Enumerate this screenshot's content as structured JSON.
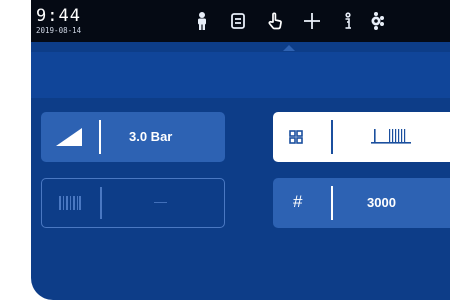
{
  "status_bar": {
    "time": "9:44",
    "date": "2019-08-14",
    "icons": [
      "person-icon",
      "document-icon",
      "hand-pointer-icon",
      "plus-icon",
      "info-icon",
      "settings-icon"
    ],
    "active_icon": "hand-pointer-icon"
  },
  "tiles": {
    "pressure_value": "3.0 Bar",
    "empty_value": "—",
    "count_value": "3000",
    "count_symbol": "#"
  },
  "colors": {
    "background": "#0d3d88",
    "tile": "#2d62b3",
    "status_bar": "#050a14"
  }
}
